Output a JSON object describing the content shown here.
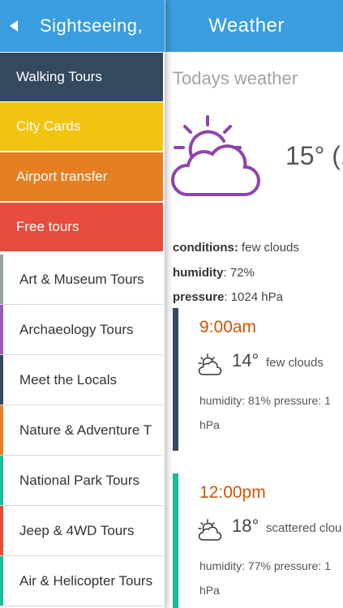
{
  "weather": {
    "title": "Weather",
    "today_heading": "Todays weather",
    "current_temp": "15° (1",
    "conditions_label": "conditions:",
    "conditions_value": "few clouds",
    "humidity_label": "humidity",
    "humidity_value": ": 72%",
    "pressure_label": "pressure",
    "pressure_value": ": 1024 hPa",
    "forecasts": [
      {
        "time": "9:00am",
        "temp": "14°",
        "condition": "few clouds",
        "details": "humidity: 81%  pressure: 1",
        "details_cont": "hPa",
        "accent": "#34495e",
        "icon": "partly-cloudy-icon"
      },
      {
        "time": "12:00pm",
        "temp": "18°",
        "condition": "scattered clou",
        "details": "humidity: 77%  pressure: 1",
        "details_cont": "hPa",
        "accent": "#1abc9c",
        "icon": "partly-cloudy-icon"
      }
    ]
  },
  "menu": {
    "title": "Sightseeing,",
    "back_icon": "back-arrow-icon",
    "featured": [
      {
        "label": "Walking Tours",
        "color": "#34495e"
      },
      {
        "label": "City Cards",
        "color": "#f1c40f"
      },
      {
        "label": "Airport transfer",
        "color": "#e67e22"
      },
      {
        "label": "Free tours",
        "color": "#e74c3c"
      }
    ],
    "categories": [
      {
        "label": "Art & Museum Tours",
        "color": "#95a5a6"
      },
      {
        "label": "Archaeology Tours",
        "color": "#9b59b6"
      },
      {
        "label": "Meet the Locals",
        "color": "#34495e"
      },
      {
        "label": "Nature & Adventure T",
        "color": "#e67e22"
      },
      {
        "label": "National Park Tours",
        "color": "#1abc9c"
      },
      {
        "label": "Jeep & 4WD Tours",
        "color": "#e74c3c"
      },
      {
        "label": "Air & Helicopter Tours",
        "color": "#1abc9c"
      }
    ]
  },
  "colors": {
    "header_blue": "#3a9de0",
    "icon_purple": "#8e44ad",
    "time_orange": "#d35400"
  }
}
